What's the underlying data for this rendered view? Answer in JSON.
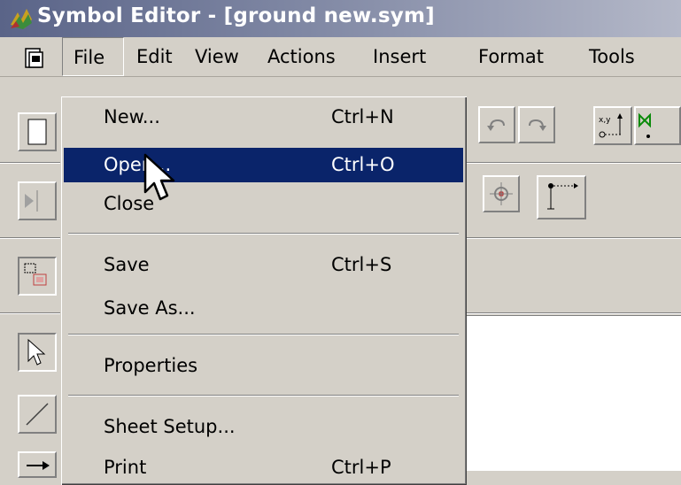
{
  "window": {
    "title": "Symbol Editor - [ground new.sym]",
    "app_icon": "symbol-editor-icon"
  },
  "menubar": {
    "items": [
      {
        "label": "File",
        "active": true
      },
      {
        "label": "Edit"
      },
      {
        "label": "View"
      },
      {
        "label": "Actions"
      },
      {
        "label": "Insert"
      },
      {
        "label": "Format"
      },
      {
        "label": "Tools"
      }
    ]
  },
  "file_menu": {
    "items": [
      {
        "label": "New...",
        "shortcut": "Ctrl+N"
      },
      {
        "label": "Open...",
        "shortcut": "Ctrl+O",
        "highlighted": true
      },
      {
        "label": "Close",
        "shortcut": ""
      },
      {
        "label": "Save",
        "shortcut": "Ctrl+S"
      },
      {
        "label": "Save As...",
        "shortcut": ""
      },
      {
        "label": "Properties",
        "shortcut": ""
      },
      {
        "label": "Sheet Setup...",
        "shortcut": ""
      },
      {
        "label": "Print",
        "shortcut": "Ctrl+P"
      }
    ]
  },
  "toolbar": {
    "icons": [
      "new-doc-icon",
      "undo-icon",
      "redo-icon",
      "xy-coordinate-icon",
      "mirror-icon",
      "flip-icon",
      "snap-point-icon",
      "connection-point-icon",
      "group-icon",
      "select-arrow-icon",
      "line-icon",
      "arrow-line-icon"
    ]
  },
  "colors": {
    "titlebar_start": "#5a6488",
    "menu_highlight": "#0a246a",
    "face": "#d4d0c8"
  }
}
